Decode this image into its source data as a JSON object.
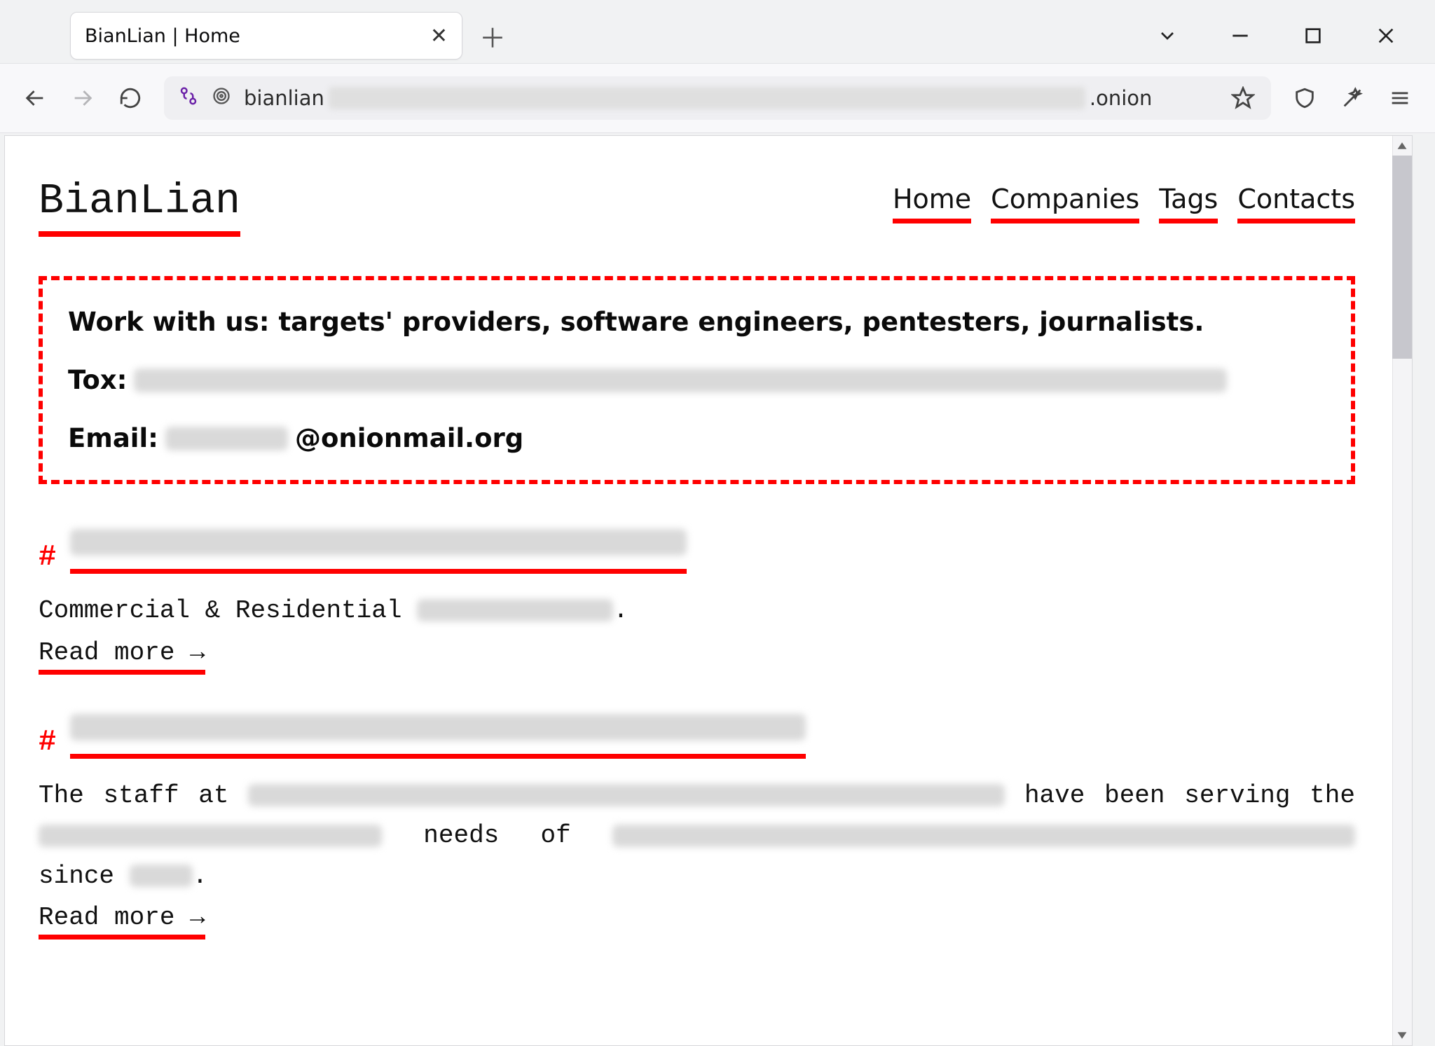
{
  "browser": {
    "tab_title": "BianLian | Home",
    "url_prefix": "bianlian",
    "url_suffix": ".onion"
  },
  "site": {
    "brand": "BianLian",
    "nav": [
      "Home",
      "Companies",
      "Tags",
      "Contacts"
    ]
  },
  "notice": {
    "headline": "Work with us: targets' providers, software engineers, pentesters, journalists.",
    "tox_label": "Tox:",
    "email_label": "Email:",
    "email_suffix": "@onionmail.org"
  },
  "posts": [
    {
      "desc_prefix": "Commercial & Residential ",
      "desc_suffix": ".",
      "read_more": "Read more →"
    },
    {
      "desc_parts": {
        "a": "The staff at ",
        "b": " have been serving the ",
        "c": " needs of ",
        "d": " since ",
        "e": "."
      },
      "read_more": "Read more →"
    }
  ]
}
